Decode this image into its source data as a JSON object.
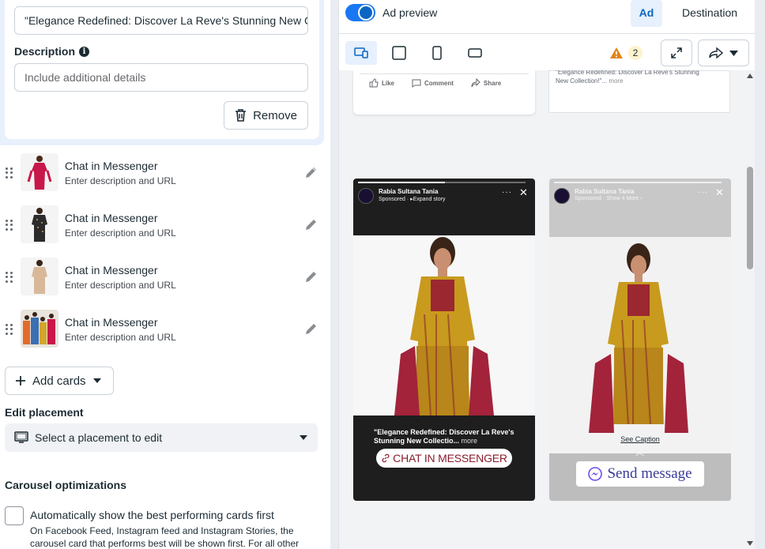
{
  "edit_card": {
    "headline_value": "\"Elegance Redefined: Discover La Reve's Stunning New C",
    "description_label": "Description",
    "description_placeholder": "Include additional details",
    "remove_label": "Remove"
  },
  "cards": [
    {
      "title": "Chat in Messenger",
      "subtitle": "Enter description and URL",
      "thumb": "pink-kurta"
    },
    {
      "title": "Chat in Messenger",
      "subtitle": "Enter description and URL",
      "thumb": "black-kurta"
    },
    {
      "title": "Chat in Messenger",
      "subtitle": "Enter description and URL",
      "thumb": "beige-kurta"
    },
    {
      "title": "Chat in Messenger",
      "subtitle": "Enter description and URL",
      "thumb": "group-photo"
    }
  ],
  "add_cards_label": "Add cards",
  "edit_placement": {
    "label": "Edit placement",
    "select_value": "Select a placement to edit"
  },
  "carousel": {
    "heading": "Carousel optimizations",
    "checkbox_label": "Automatically show the best performing cards first",
    "help_text": "On Facebook Feed, Instagram feed and Instagram Stories, the carousel card that performs best will be shown first. For all other"
  },
  "preview": {
    "toggle_label": "Ad preview",
    "tab_ad": "Ad",
    "tab_destination": "Destination",
    "warning_count": "2",
    "accent_color": "#1877f2"
  },
  "feed_post": {
    "like": "Like",
    "comment": "Comment",
    "share": "Share",
    "ig_caption": "\"Elegance Redefined: Discover La Reve's Stunning New Collection!\"...",
    "ig_more": "more"
  },
  "fb_story": {
    "account": "Rabia Sultana Tania",
    "meta": "Sponsored · ▸Expand story",
    "caption": "\"Elegance Redefined: Discover La Reve's Stunning New Collectio...",
    "caption_more": "more",
    "cta": "CHAT IN MESSENGER"
  },
  "ig_story": {
    "account": "Rabia Sultana Tania",
    "meta": "Sponsored · Show 4 More ›",
    "see_caption": "See Caption",
    "cta": "Send message"
  }
}
